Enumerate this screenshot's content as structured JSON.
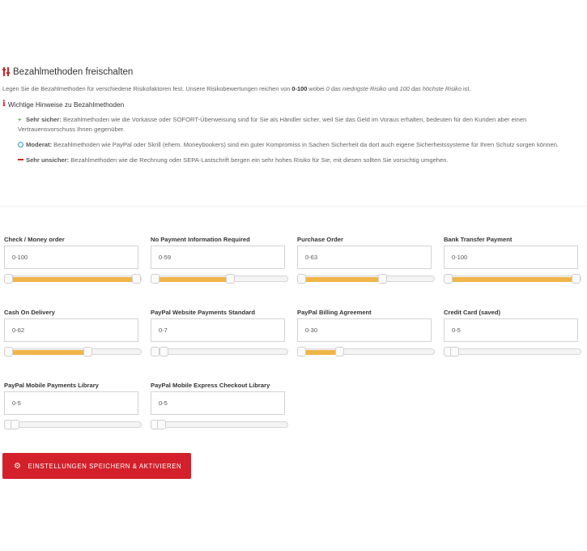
{
  "header": {
    "title": "Bezahlmethoden freischalten",
    "subtitle_prefix": "Legen Sie die Bezahlmethoden für verschiedene Risikofaktoren fest. Unsere Risikobewertungen reichen von ",
    "subtitle_range": "0-100",
    "subtitle_mid1": " wobei ",
    "subtitle_low": "0 das niedrigste Risiko",
    "subtitle_mid2": " und ",
    "subtitle_high": "100 das höchste Risiko",
    "subtitle_end": " ist.",
    "hints_heading": "Wichtige Hinweise zu Bezahlmethoden"
  },
  "hints": [
    {
      "lead": "Sehr sicher:",
      "text": " Bezahlmethoden wie die Vorkasse oder SOFORT-Überweisung sind für Sie als Händler sicher, weil Sie das Geld im Voraus erhalten, bedeuten für den Kunden aber einen Vertrauensvorschuss Ihnen gegenüber."
    },
    {
      "lead": "Moderat:",
      "text": " Bezahlmethoden wie PayPal oder Skrill (ehem. Moneybookers) sind ein guter Kompromiss in Sachen Sicherheit da dort auch eigene Sicherheitssysteme für Ihren Schutz sorgen können."
    },
    {
      "lead": "Sehr unsicher:",
      "text": " Bezahlmethoden wie die Rechnung oder SEPA-Lastschrift bergen ein sehr hohes Risiko für Sie, mit diesen sollten Sie vorsichtig umgehen."
    }
  ],
  "methods": [
    {
      "label": "Check / Money order",
      "value": "0-100",
      "max": 100
    },
    {
      "label": "No Payment Information Required",
      "value": "0-59",
      "max": 59
    },
    {
      "label": "Purchase Order",
      "value": "0-63",
      "max": 63
    },
    {
      "label": "Bank Transfer Payment",
      "value": "0-100",
      "max": 100
    },
    {
      "label": "Cash On Delivery",
      "value": "0-62",
      "max": 62
    },
    {
      "label": "PayPal Website Payments Standard",
      "value": "0-7",
      "max": 7
    },
    {
      "label": "PayPal Billing Agreement",
      "value": "0-30",
      "max": 30
    },
    {
      "label": "Credit Card (saved)",
      "value": "0-5",
      "max": 5
    },
    {
      "label": "PayPal Mobile Payments Library",
      "value": "0-5",
      "max": 5
    },
    {
      "label": "PayPal Mobile Express Checkout Library",
      "value": "0-5",
      "max": 5
    }
  ],
  "save_button": {
    "label": "EINSTELLUNGEN SPEICHERN & AKTIVIEREN"
  },
  "colors": {
    "accent": "#d3202a",
    "slider_fill": "#f0b54a"
  }
}
